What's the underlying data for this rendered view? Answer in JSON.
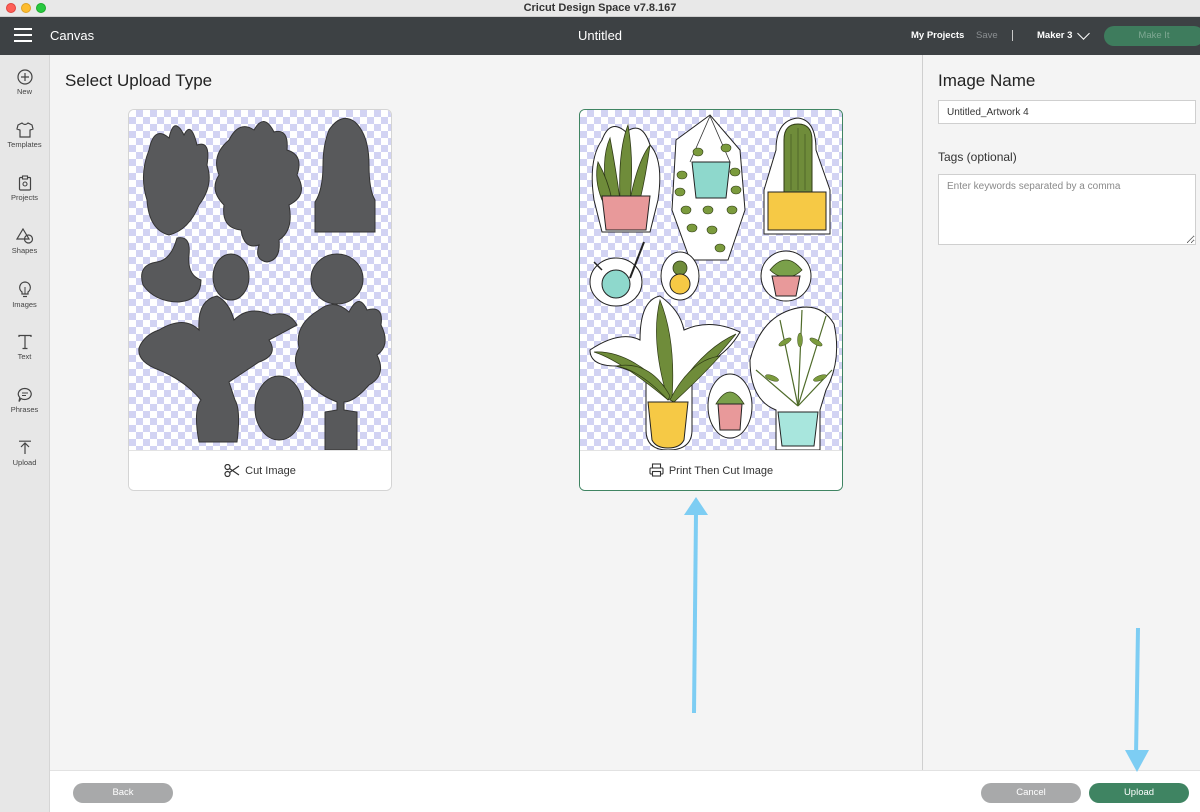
{
  "window": {
    "app_title": "Cricut Design Space  v7.8.167"
  },
  "header": {
    "canvas_label": "Canvas",
    "doc_title": "Untitled",
    "my_projects": "My Projects",
    "save": "Save",
    "machine": "Maker 3",
    "make_it": "Make It"
  },
  "sidebar": {
    "items": [
      {
        "label": "New",
        "icon": "plus-circle-icon"
      },
      {
        "label": "Templates",
        "icon": "tshirt-icon"
      },
      {
        "label": "Projects",
        "icon": "clipboard-icon"
      },
      {
        "label": "Shapes",
        "icon": "shapes-icon"
      },
      {
        "label": "Images",
        "icon": "lightbulb-icon"
      },
      {
        "label": "Text",
        "icon": "text-icon"
      },
      {
        "label": "Phrases",
        "icon": "speech-bubble-icon"
      },
      {
        "label": "Upload",
        "icon": "upload-icon"
      }
    ]
  },
  "main": {
    "title": "Select Upload Type",
    "options": [
      {
        "label": "Cut Image",
        "icon": "scissors-icon",
        "selected": false
      },
      {
        "label": "Print Then Cut Image",
        "icon": "printer-icon",
        "selected": true
      }
    ]
  },
  "right_panel": {
    "image_name_label": "Image Name",
    "image_name_value": "Untitled_Artwork 4",
    "tags_label": "Tags (optional)",
    "tags_placeholder": "Enter keywords separated by a comma"
  },
  "footer": {
    "back": "Back",
    "cancel": "Cancel",
    "upload": "Upload"
  },
  "colors": {
    "header_bg": "#3d4144",
    "accent_green": "#3f8462",
    "annotation_arrow": "#7dcdf3",
    "checker": "#d2d3f3"
  }
}
